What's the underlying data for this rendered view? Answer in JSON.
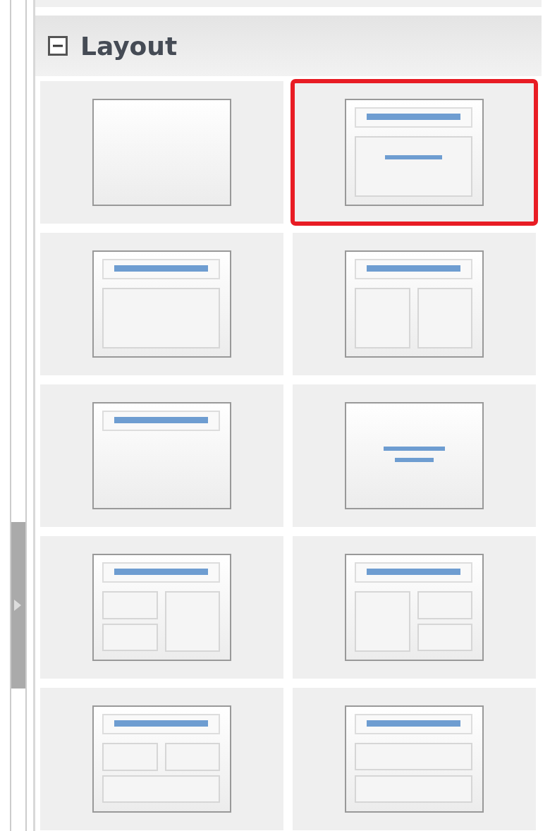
{
  "panel": {
    "title": "Layout",
    "expanded": true
  },
  "layouts": [
    {
      "kind": "blank",
      "selected": false
    },
    {
      "kind": "title-subtitle",
      "selected": true
    },
    {
      "kind": "title-content",
      "selected": false
    },
    {
      "kind": "title-two-content",
      "selected": false
    },
    {
      "kind": "title-only",
      "selected": false
    },
    {
      "kind": "centered-text",
      "selected": false
    },
    {
      "kind": "title-two-content-and-content",
      "selected": false
    },
    {
      "kind": "title-content-and-two-content",
      "selected": false
    },
    {
      "kind": "title-two-content-over-content",
      "selected": false
    },
    {
      "kind": "title-content-over-content",
      "selected": false
    }
  ]
}
